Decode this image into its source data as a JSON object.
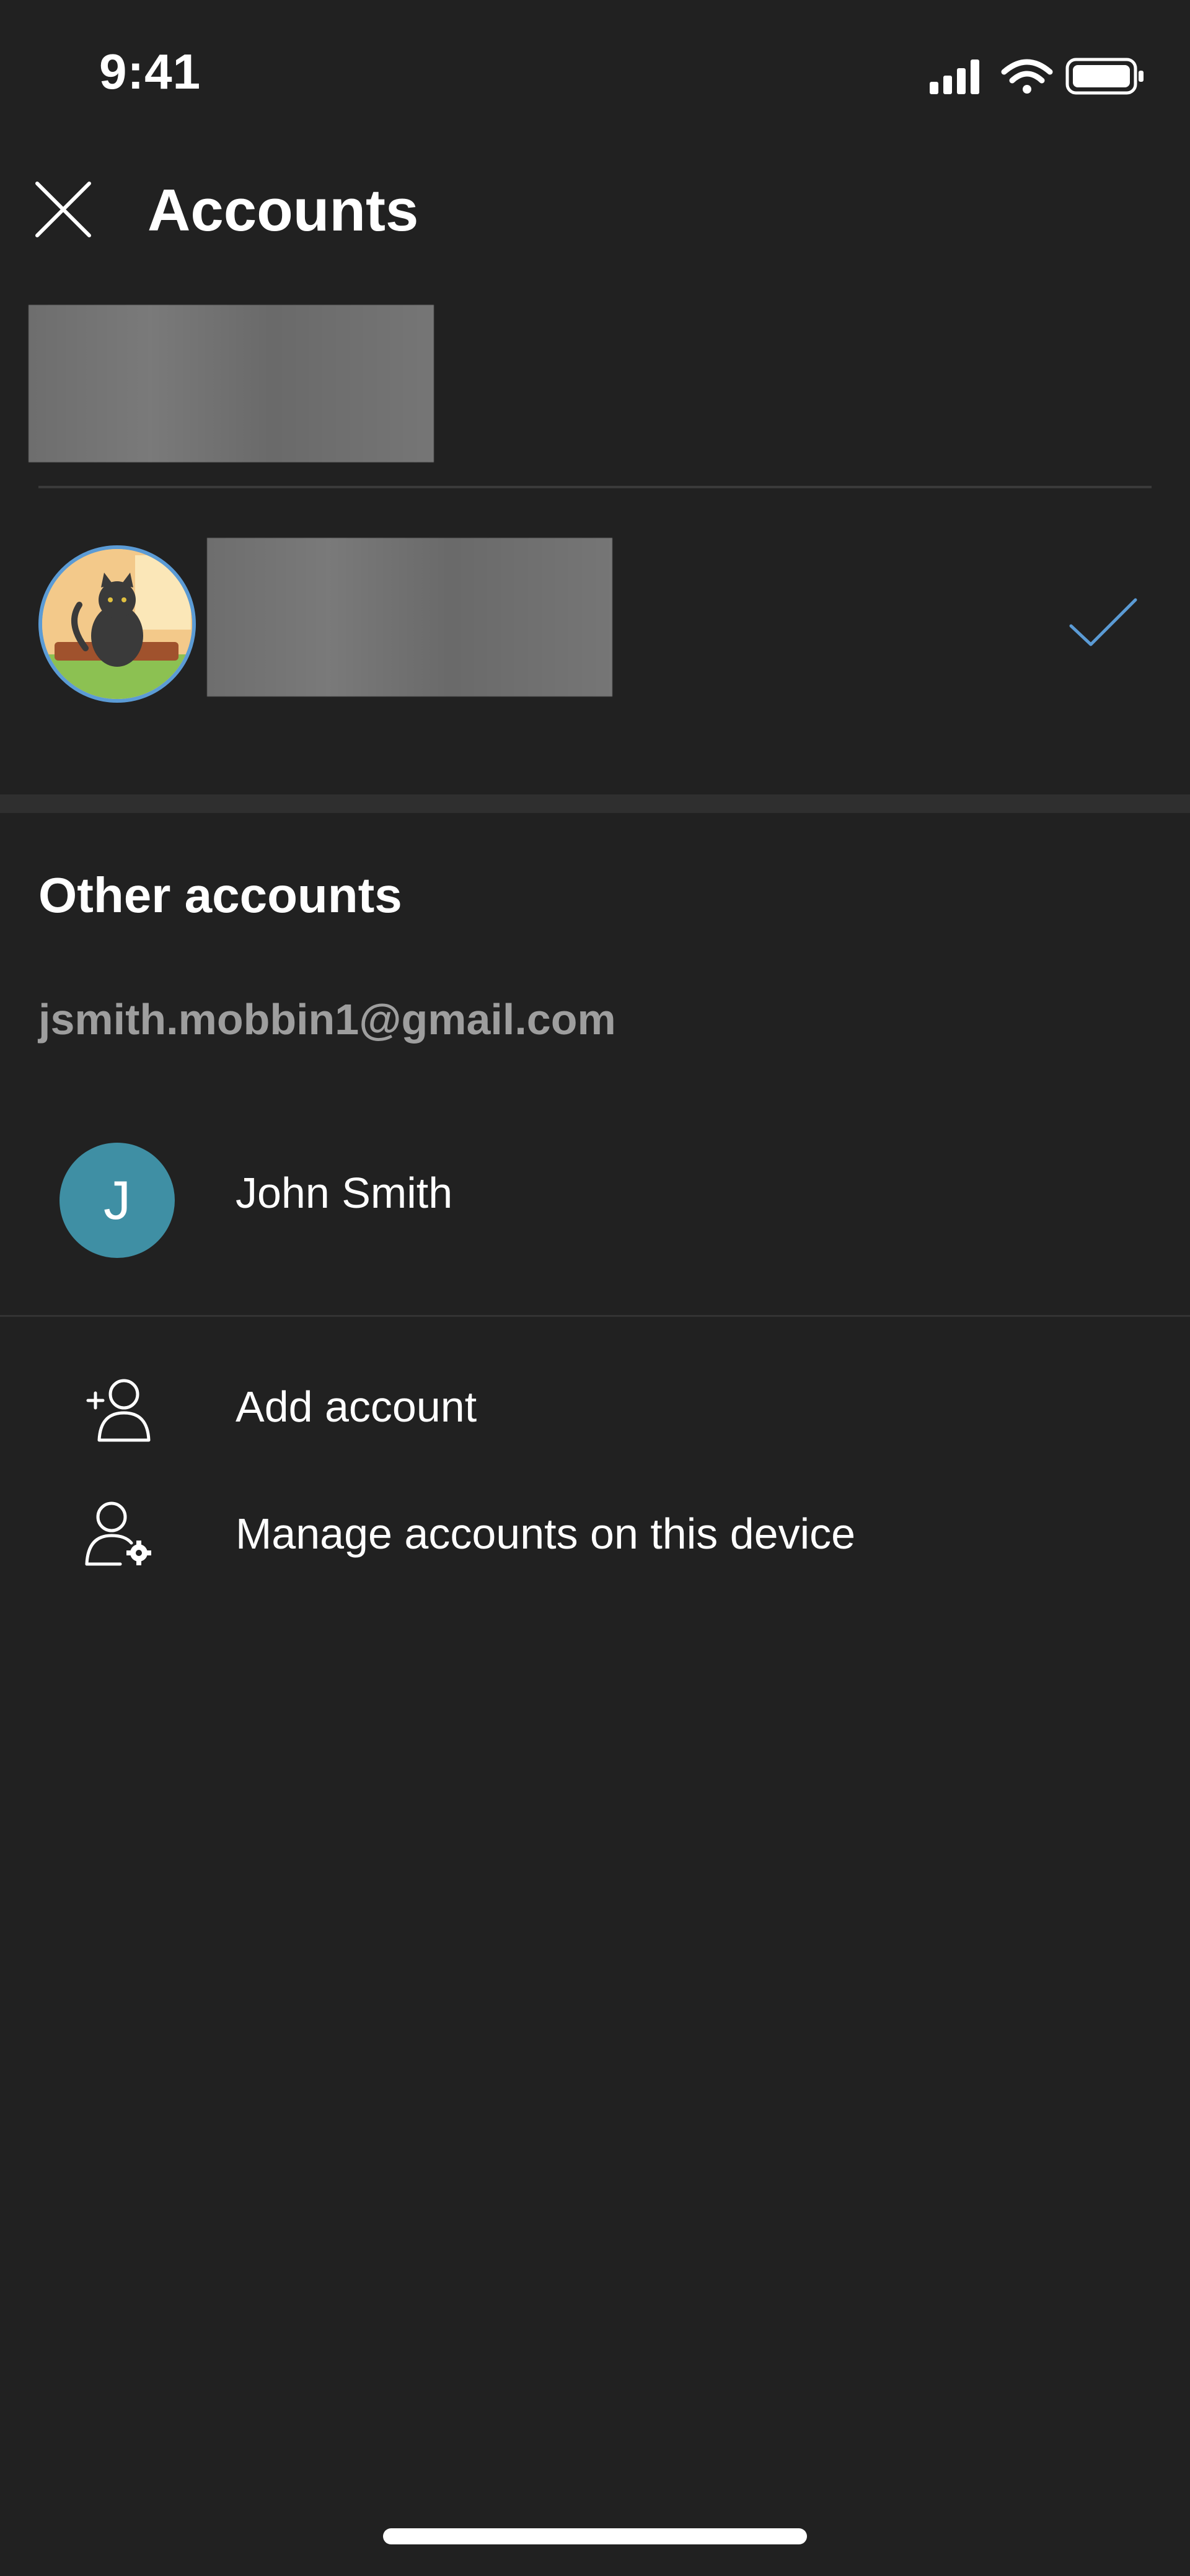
{
  "status_bar": {
    "time": "9:41",
    "icons": [
      "signal-icon",
      "wifi-icon",
      "battery-icon"
    ]
  },
  "header": {
    "title": "Accounts",
    "close_icon": "close-icon"
  },
  "current_account": {
    "selected_icon": "checkmark-icon",
    "accent_color": "#5b9bd5"
  },
  "other_accounts": {
    "section_title": "Other accounts",
    "email": "jsmith.mobbin1@gmail.com",
    "accounts": [
      {
        "initial": "J",
        "name": "John Smith",
        "avatar_color": "#3f8fa4"
      }
    ]
  },
  "actions": [
    {
      "label": "Add account",
      "icon": "add-person-icon"
    },
    {
      "label": "Manage accounts on this device",
      "icon": "manage-person-icon"
    }
  ]
}
